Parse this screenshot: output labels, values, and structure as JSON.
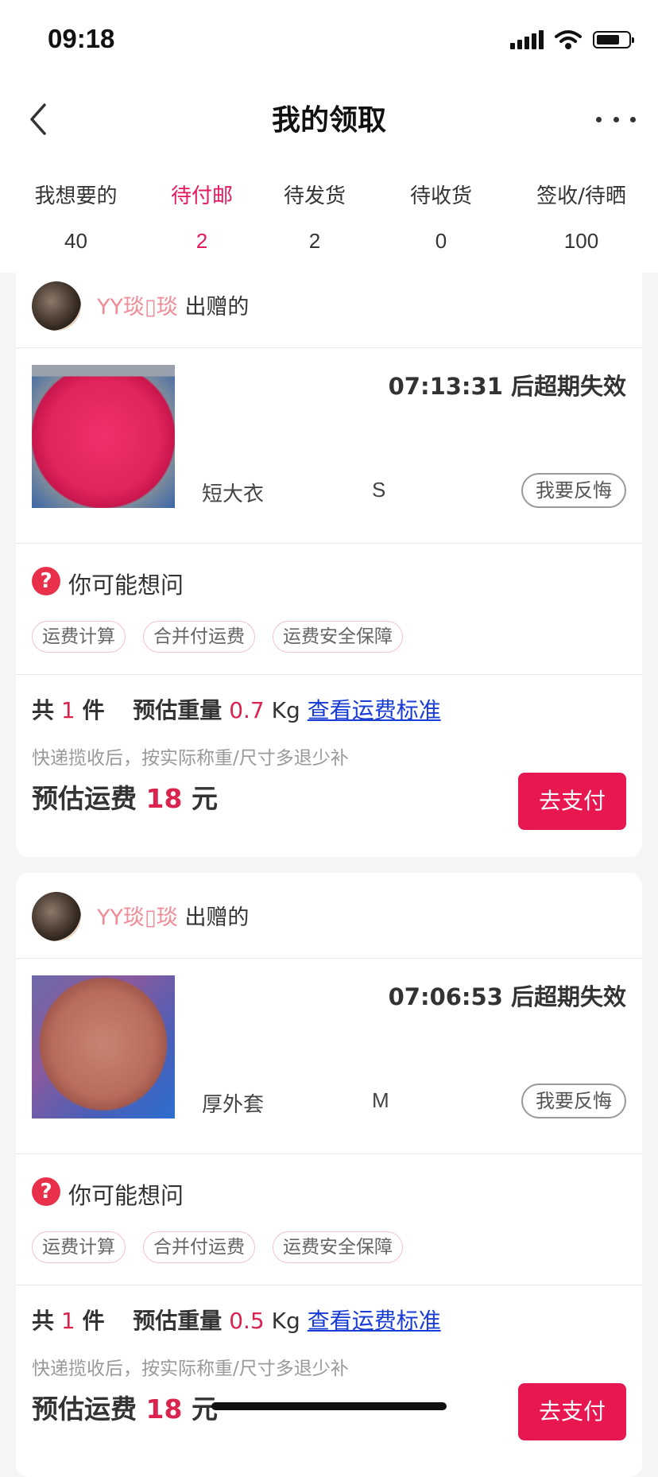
{
  "status_bar": {
    "time": "09:18"
  },
  "nav": {
    "title": "我的领取"
  },
  "tabs": [
    {
      "label": "我想要的",
      "count": "40"
    },
    {
      "label": "待付邮",
      "count": "2",
      "active": true
    },
    {
      "label": "待发货",
      "count": "2"
    },
    {
      "label": "待收货",
      "count": "0"
    },
    {
      "label": "签收/待晒",
      "count": "100"
    }
  ],
  "orders": [
    {
      "donor_name": "YY琰▯琰",
      "donor_suffix": "出赠的",
      "countdown": "07:13:31 后超期失效",
      "item_name": "短大衣",
      "item_size": "S",
      "regret_label": "我要反悔",
      "faq_title": "你可能想问",
      "faq_chips": [
        "运费计算",
        "合并付运费",
        "运费安全保障"
      ],
      "count_prefix": "共",
      "count_value": "1",
      "count_suffix": "件",
      "weight_label": "预估重量",
      "weight_value": "0.7",
      "weight_unit": "Kg",
      "fee_standard_link": "查看运费标准",
      "note": "快递揽收后，按实际称重/尺寸多退少补",
      "fee_label": "预估运费",
      "fee_value": "18",
      "fee_unit": "元",
      "pay_label": "去支付"
    },
    {
      "donor_name": "YY琰▯琰",
      "donor_suffix": "出赠的",
      "countdown": "07:06:53 后超期失效",
      "item_name": "厚外套",
      "item_size": "M",
      "regret_label": "我要反悔",
      "faq_title": "你可能想问",
      "faq_chips": [
        "运费计算",
        "合并付运费",
        "运费安全保障"
      ],
      "count_prefix": "共",
      "count_value": "1",
      "count_suffix": "件",
      "weight_label": "预估重量",
      "weight_value": "0.5",
      "weight_unit": "Kg",
      "fee_standard_link": "查看运费标准",
      "note": "快递揽收后，按实际称重/尺寸多退少补",
      "fee_label": "预估运费",
      "fee_value": "18",
      "fee_unit": "元",
      "pay_label": "去支付"
    }
  ],
  "colors": {
    "accent": "#e5195e",
    "link": "#1a3cd6",
    "donor": "#f08c97"
  },
  "icons": [
    "signal-icon",
    "wifi-icon",
    "battery-icon",
    "back-icon",
    "more-icon",
    "question-icon"
  ]
}
